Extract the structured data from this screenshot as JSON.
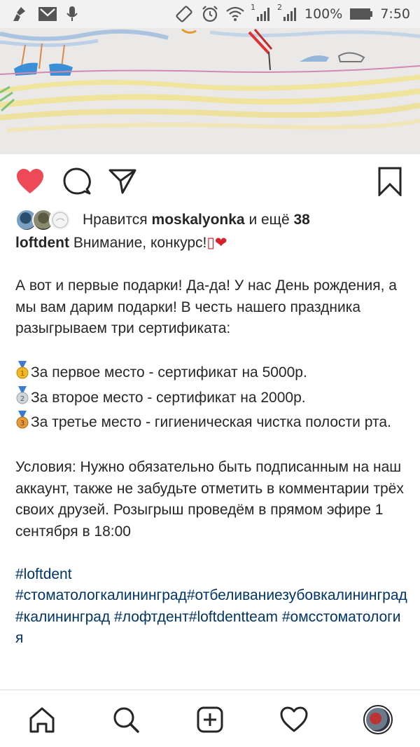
{
  "status_bar": {
    "battery": "100%",
    "time": "7:50",
    "sim1": "1",
    "sim2": "2",
    "icons": [
      "broom-icon",
      "mail-icon",
      "mic-icon",
      "vibrate-icon",
      "alarm-icon",
      "wifi-icon",
      "signal-icon",
      "battery-icon"
    ]
  },
  "post": {
    "actions": [
      "heart-icon",
      "comment-icon",
      "share-icon",
      "bookmark-icon"
    ],
    "colors": {
      "liked": "#ed4956",
      "hashtag": "#003569",
      "text": "#262626"
    },
    "likes": {
      "prefix": "Нравится",
      "user": "moskalyonka",
      "middle": "и ещё",
      "count": "38"
    },
    "caption": {
      "username": "loftdent",
      "headline": "Внимание, конкурс!",
      "headline_extra": "▯❤",
      "intro": "А вот и первые подарки! Да-да! У нас День рождения, а мы вам дарим подарки! В честь нашего праздника разыгрываем три сертификата:",
      "prizes": [
        {
          "medal": "1",
          "text": "За первое место - сертификат на 5000р."
        },
        {
          "medal": "2",
          "text": "За второе место - сертификат на 2000р."
        },
        {
          "medal": "3",
          "text": "За третье место - гигиеническая чистка полости рта."
        }
      ],
      "conditions": "Условия: Нужно обязательно быть подписанным на наш аккаунт, также не забудьте отметить в комментарии трёх своих друзей. Розыгрыш проведём в прямом эфире 1 сентября в 18:00",
      "hashtag_line1": "#loftdent",
      "hashtags": [
        "#стоматологкалининград",
        "#отбеливаниезубовкалининград",
        "#калининград",
        " #лофтдент",
        "#loftdentteam",
        " #омсстоматология"
      ]
    }
  },
  "bottom_nav": [
    "home-icon",
    "search-icon",
    "add-post-icon",
    "activity-heart-icon",
    "profile-avatar"
  ]
}
